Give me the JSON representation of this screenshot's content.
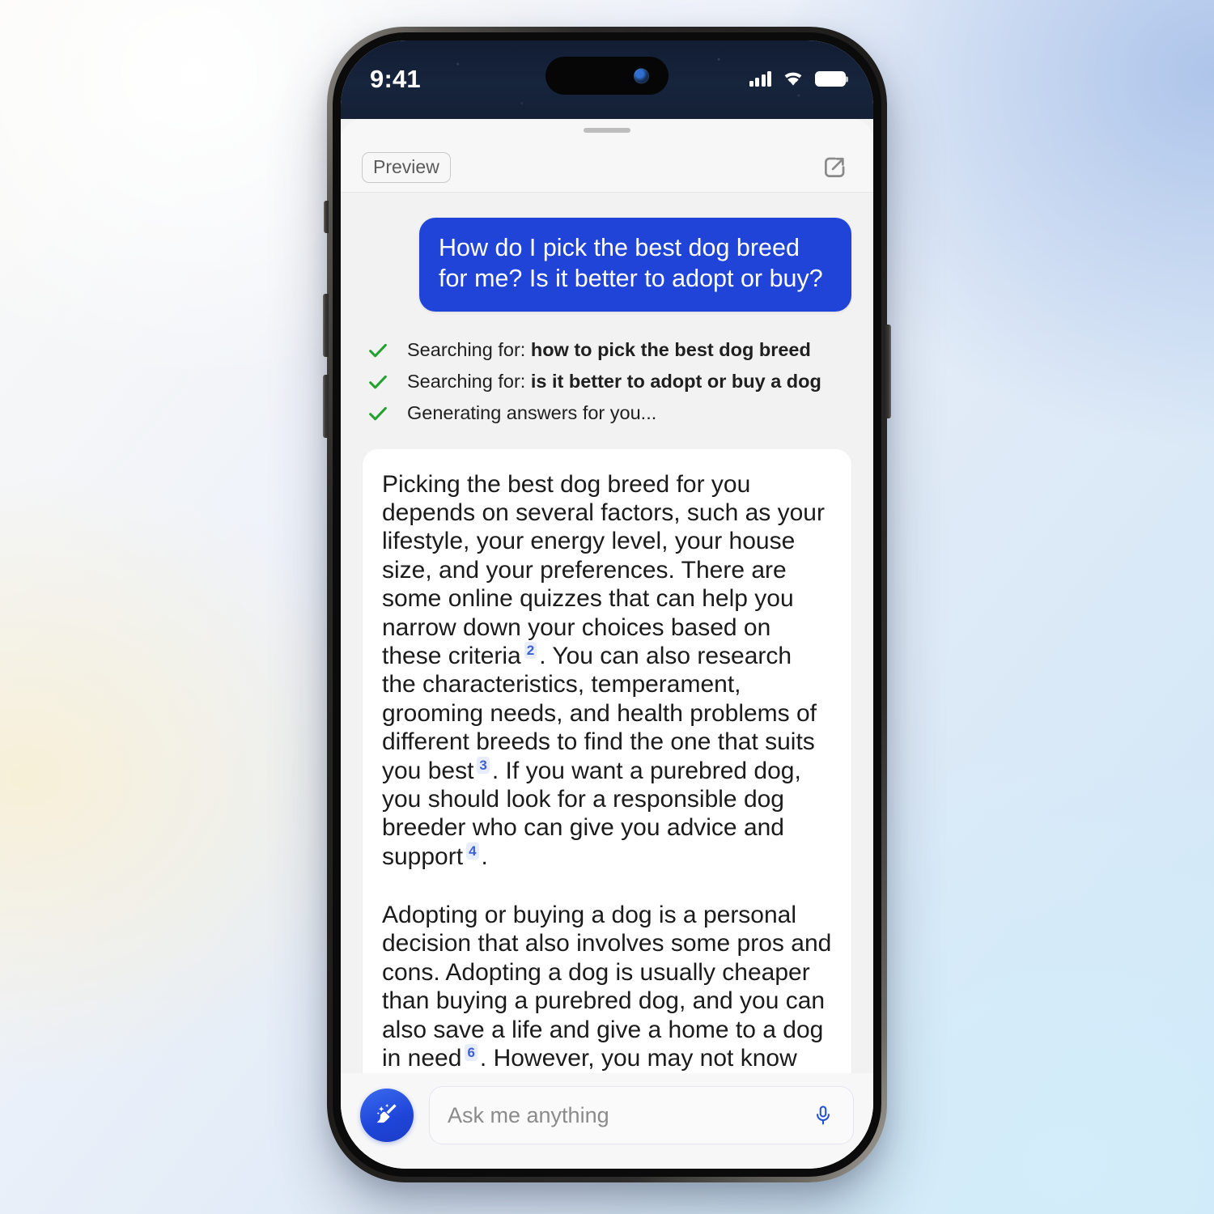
{
  "status_bar": {
    "time": "9:41",
    "signal_icon": "cellular-signal-icon",
    "wifi_icon": "wifi-icon",
    "battery_icon": "battery-full-icon"
  },
  "app_bar": {
    "preview_label": "Preview",
    "share_icon": "share-icon"
  },
  "chat": {
    "user_message": "How do I pick the best dog breed for me? Is it better to adopt or buy?",
    "steps": [
      {
        "prefix": "Searching for: ",
        "query": "how to pick the best dog breed",
        "icon": "check-icon",
        "done": true
      },
      {
        "prefix": "Searching for: ",
        "query": "is it better to adopt or buy a dog",
        "icon": "check-icon",
        "done": true
      },
      {
        "prefix": "Generating answers for you...",
        "query": "",
        "icon": "check-icon",
        "done": true
      }
    ],
    "answer": {
      "paragraph1_part1": "Picking the best dog breed for you depends on several factors, such as your lifestyle, your energy level, your house size, and your preferences. There are some online quizzes that can help you narrow down your choices based on these criteria",
      "citation1": "2",
      "paragraph1_part2": ". You can also research the characteristics, temperament, grooming needs, and health problems of different breeds to find the one that suits you best",
      "citation2": "3",
      "paragraph1_part3": ". If you want a purebred dog, you should look for a responsible dog breeder who can give you advice and support",
      "citation3": "4",
      "paragraph1_part4": ".",
      "paragraph2_part1": "Adopting or buying a dog is a personal decision that also involves some pros and cons. Adopting a dog is usually cheaper than buying a purebred dog, and you can also save a life and give a home to a dog in need",
      "citation4": "6",
      "paragraph2_part2": ". However, you may not know the dog's history, health,"
    }
  },
  "composer": {
    "new_chat_icon": "broom-sparkle-icon",
    "input_placeholder": "Ask me anything",
    "input_value": "",
    "mic_icon": "microphone-icon"
  },
  "colors": {
    "user_bubble": "#2044d8",
    "check_green": "#22a12e",
    "citation_blue": "#3d5fd4",
    "accent_blue": "#1f45d8",
    "chat_background": "#f2f2f2",
    "card_background": "#ffffff"
  }
}
